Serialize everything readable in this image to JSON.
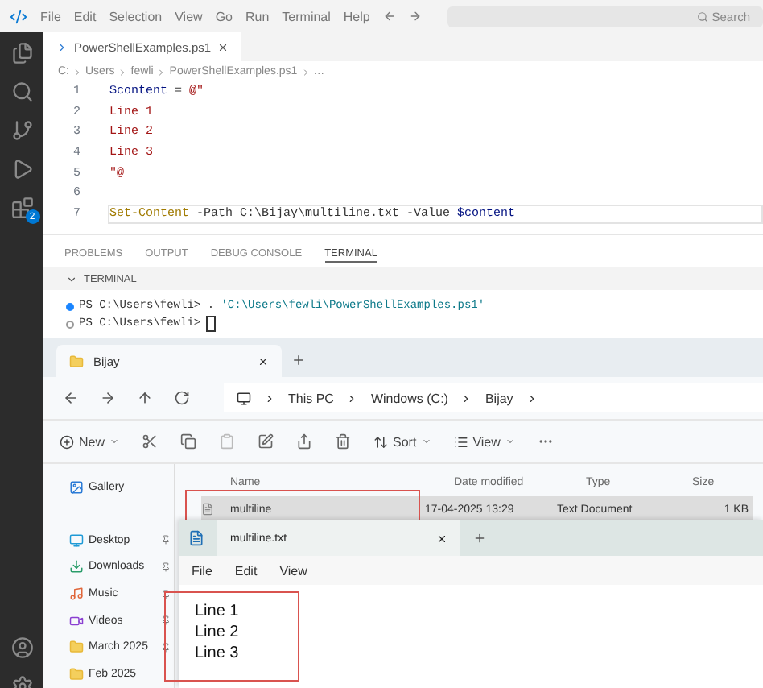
{
  "menu": [
    "File",
    "Edit",
    "Selection",
    "View",
    "Go",
    "Run",
    "Terminal",
    "Help"
  ],
  "search": {
    "placeholder": "Search"
  },
  "activity_bar": {
    "badge": "2"
  },
  "editor": {
    "tab": {
      "label": "PowerShellExamples.ps1",
      "selected": true
    },
    "breadcrumb": [
      "C:",
      "Users",
      "fewli",
      "PowerShellExamples.ps1",
      "…"
    ],
    "lines": [
      {
        "number": "1",
        "current": false,
        "tokens": [
          {
            "kind": "variable",
            "text": "$content"
          },
          {
            "kind": "operator",
            "text": " = "
          },
          {
            "kind": "string",
            "text": "@\""
          }
        ]
      },
      {
        "number": "2",
        "current": false,
        "tokens": [
          {
            "kind": "string",
            "text": "Line 1"
          }
        ]
      },
      {
        "number": "3",
        "current": false,
        "tokens": [
          {
            "kind": "string",
            "text": "Line 2"
          }
        ]
      },
      {
        "number": "4",
        "current": false,
        "tokens": [
          {
            "kind": "string",
            "text": "Line 3"
          }
        ]
      },
      {
        "number": "5",
        "current": false,
        "tokens": [
          {
            "kind": "string",
            "text": "\"@"
          }
        ]
      },
      {
        "number": "6",
        "current": false
      },
      {
        "number": "7",
        "current": true,
        "tokens": [
          {
            "kind": "command",
            "text": "Set-Content"
          },
          {
            "kind": "plain",
            "text": " -Path C:\\Bijay\\multiline.txt -Value "
          },
          {
            "kind": "variable",
            "text": "$content"
          }
        ]
      }
    ]
  },
  "panel": {
    "tabs": [
      {
        "label": "PROBLEMS",
        "selected": false
      },
      {
        "label": "OUTPUT",
        "selected": false
      },
      {
        "label": "DEBUG CONSOLE",
        "selected": false
      },
      {
        "label": "TERMINAL",
        "selected": true
      }
    ],
    "section": "TERMINAL",
    "terminal": [
      {
        "prompt": "PS C:\\Users\\fewli>",
        "done": true,
        "tokens": [
          {
            "kind": "plain",
            "text": "."
          },
          {
            "kind": "string",
            "text": "'C:\\Users\\fewli\\PowerShellExamples.ps1'"
          }
        ]
      },
      {
        "prompt": "PS C:\\Users\\fewli>",
        "done": false,
        "cursor": true
      }
    ]
  },
  "explorer": {
    "tab": {
      "label": "Bijay",
      "selected": true
    },
    "breadcrumb": [
      "This PC",
      "Windows (C:)",
      "Bijay"
    ],
    "toolbar": {
      "new": "New",
      "sort": "Sort",
      "view": "View"
    },
    "sidebar": [
      {
        "kind": "gallery",
        "label": "Gallery",
        "pinned": false
      },
      {
        "kind": "desktop",
        "label": "Desktop",
        "pinned": true
      },
      {
        "kind": "download",
        "label": "Downloads",
        "pinned": true
      },
      {
        "kind": "music",
        "label": "Music",
        "pinned": true
      },
      {
        "kind": "video",
        "label": "Videos",
        "pinned": true
      },
      {
        "kind": "folder",
        "label": "March 2025",
        "pinned": true
      },
      {
        "kind": "folder",
        "label": "Feb 2025",
        "pinned": false
      }
    ],
    "columns": [
      "Name",
      "Date modified",
      "Type",
      "Size"
    ],
    "rows": [
      {
        "name": "multiline",
        "date": "17-04-2025 13:29",
        "type": "Text Document",
        "size": "1 KB",
        "selected": true,
        "highlighted": true
      }
    ]
  },
  "notepad": {
    "tab": {
      "label": "multiline.txt",
      "selected": true
    },
    "menu": [
      "File",
      "Edit",
      "View"
    ],
    "lines": [
      "Line 1",
      "Line 2",
      "Line 3"
    ],
    "highlighted": true
  }
}
